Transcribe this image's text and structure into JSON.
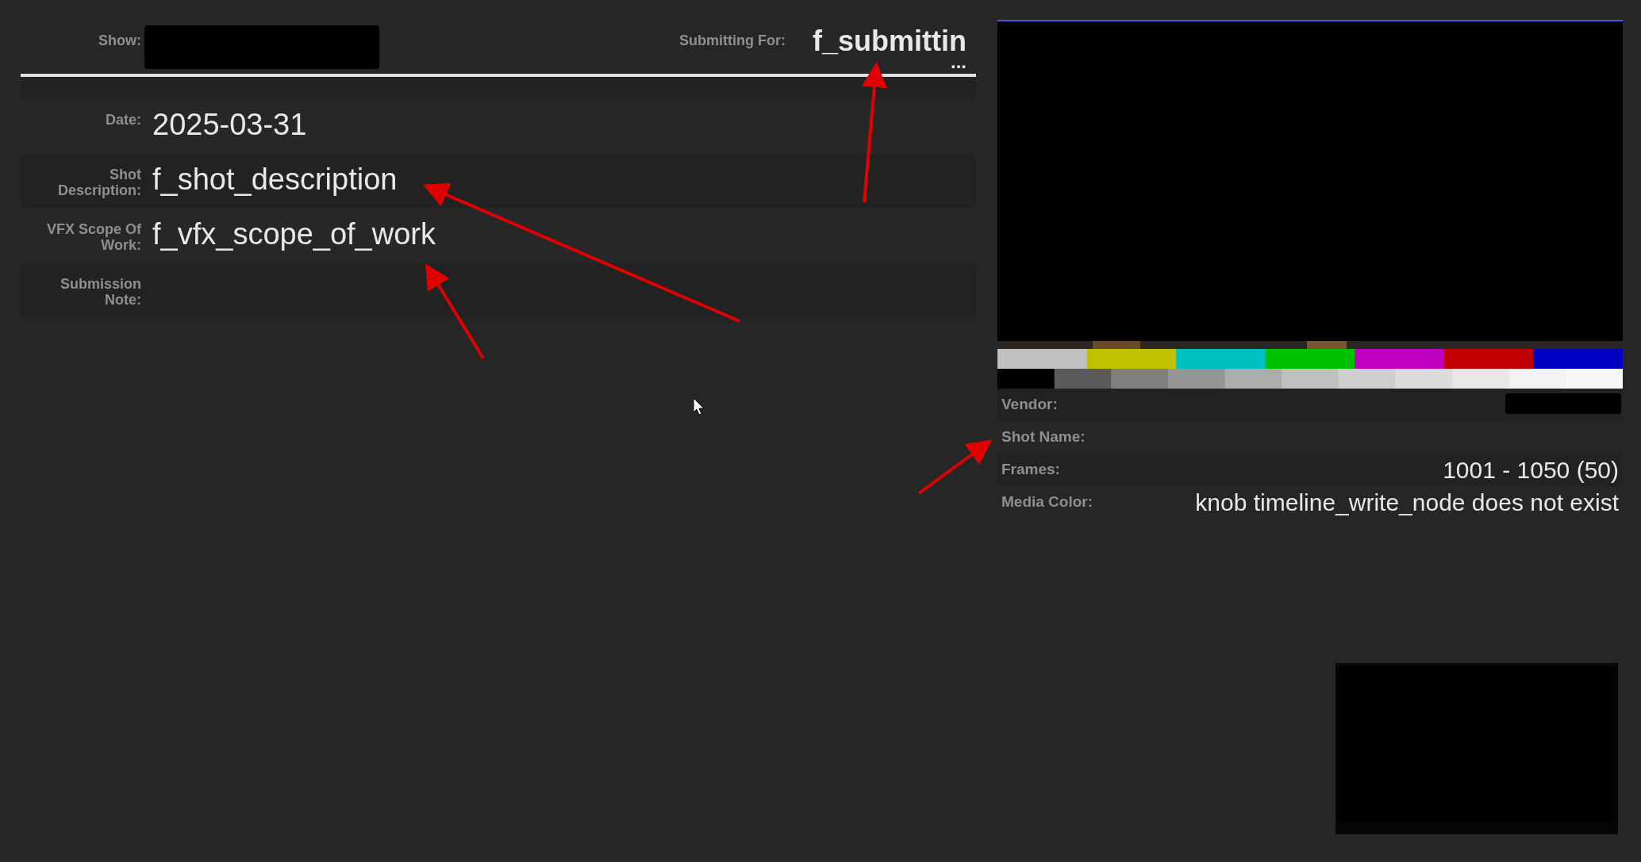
{
  "header": {
    "show": {
      "label": "Show:",
      "redacted": true
    },
    "submitting_for": {
      "label": "Submitting For:",
      "value": "f_submittin",
      "overflow": "..."
    }
  },
  "fields": [
    {
      "label": "Date:",
      "value": "2025-03-31"
    },
    {
      "label": "Shot Description:",
      "value": "f_shot_description"
    },
    {
      "label": "VFX Scope Of Work:",
      "value": "f_vfx_scope_of_work"
    },
    {
      "label": "Submission Note:"
    }
  ],
  "info": [
    {
      "label": "Vendor:",
      "redacted": true
    },
    {
      "label": "Shot Name:"
    },
    {
      "label": "Frames:",
      "value": "1001 - 1050 (50)"
    },
    {
      "label": "Media Color:",
      "value": "knob timeline_write_node does not exist"
    }
  ]
}
